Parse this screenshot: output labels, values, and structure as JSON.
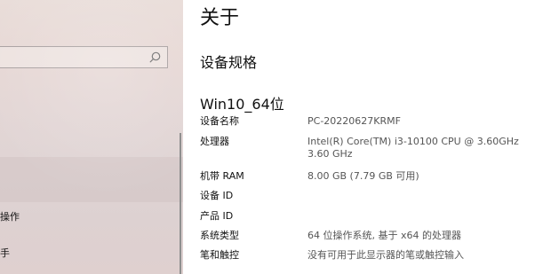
{
  "sidebar": {
    "search_placeholder": "",
    "icon": "search-icon",
    "items": [
      {
        "label": "操作"
      },
      {
        "label": "手"
      }
    ]
  },
  "content": {
    "page_title": "关于",
    "section_title": "设备规格",
    "device_name": "Win10_64位",
    "specs": [
      {
        "label": "设备名称",
        "value": "PC-20220627KRMF"
      },
      {
        "label": "处理器",
        "value": "Intel(R) Core(TM) i3-10100 CPU @ 3.60GHz\n3.60 GHz"
      },
      {
        "label": "机带 RAM",
        "value": "8.00 GB (7.79 GB 可用)"
      },
      {
        "label": "设备 ID",
        "value": ""
      },
      {
        "label": "产品 ID",
        "value": ""
      },
      {
        "label": "系统类型",
        "value": "64 位操作系统, 基于 x64 的处理器"
      },
      {
        "label": "笔和触控",
        "value": "没有可用于此显示器的笔或触控输入"
      }
    ]
  },
  "colors": {
    "sidebar_background": "#e3d6d5",
    "text_primary": "#111111",
    "text_secondary": "#555555"
  }
}
